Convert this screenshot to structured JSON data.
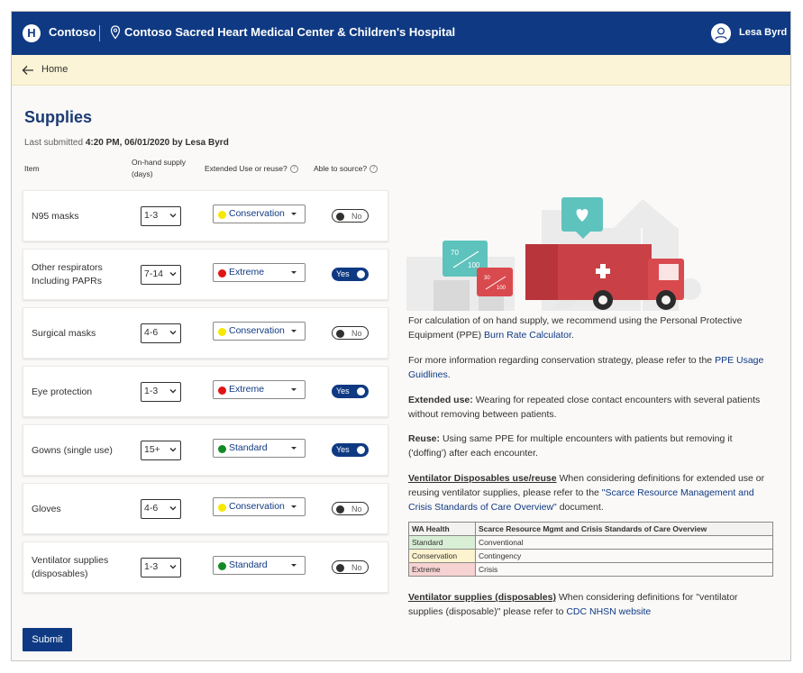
{
  "header": {
    "logo_letter": "H",
    "brand": "Contoso",
    "facility": "Contoso Sacred Heart Medical Center & Children's Hospital",
    "user_name": "Lesa Byrd"
  },
  "breadcrumb": {
    "home_label": "Home"
  },
  "page": {
    "title": "Supplies",
    "last_submitted_prefix": "Last submitted",
    "last_submitted_value": "4:20 PM, 06/01/2020 by Lesa Byrd"
  },
  "columns": {
    "item": "Item",
    "on_hand_line1": "On-hand supply",
    "on_hand_line2": "(days)",
    "extended": "Extended Use or reuse?",
    "able": "Able to source?"
  },
  "colors": {
    "conservation": "#f6e800",
    "extreme": "#e01414",
    "standard": "#138a25",
    "primary": "#0f3a83"
  },
  "rows": [
    {
      "name_line1": "N95 masks",
      "name_line2": "",
      "days": "1-3",
      "level": "Conservation",
      "source": "No"
    },
    {
      "name_line1": "Other respirators",
      "name_line2": "Including PAPRs",
      "days": "7-14",
      "level": "Extreme",
      "source": "Yes"
    },
    {
      "name_line1": "Surgical masks",
      "name_line2": "",
      "days": "4-6",
      "level": "Conservation",
      "source": "No"
    },
    {
      "name_line1": "Eye protection",
      "name_line2": "",
      "days": "1-3",
      "level": "Extreme",
      "source": "Yes"
    },
    {
      "name_line1": "Gowns (single use)",
      "name_line2": "",
      "days": "15+",
      "level": "Standard",
      "source": "Yes"
    },
    {
      "name_line1": "Gloves",
      "name_line2": "",
      "days": "4-6",
      "level": "Conservation",
      "source": "No"
    },
    {
      "name_line1": "Ventilator supplies",
      "name_line2": "(disposables)",
      "days": "1-3",
      "level": "Standard",
      "source": "No"
    }
  ],
  "submit_label": "Submit",
  "illustration": {
    "badge1_top": "70",
    "badge1_bottom": "100",
    "badge2_top": "30",
    "badge2_bottom": "100"
  },
  "info": {
    "p1_text": "For calculation of on hand supply, we recommend using the Personal Protective Equipment (PPE)",
    "p1_link": "Burn Rate Calculator",
    "p2_text": "For more information regarding conservation strategy, please refer to the",
    "p2_link": "PPE Usage Guidlines",
    "p3_bold": "Extended use:",
    "p3_text": "Wearing for repeated close contact encounters with several patients without removing between patients.",
    "p4_bold": "Reuse:",
    "p4_text": "Using same PPE for multiple encounters with patients but removing it ('doffing') after each encounter.",
    "p5_bold": "Ventilator Disposables use/reuse",
    "p5_text": "When considering definitions for extended use or reusing ventilator supplies, please refer to the",
    "p5_link": "\"Scarce Resource Management and Crisis Standards of Care Overview\"",
    "p5_tail": "document.",
    "p6_bold": "Ventilator supplies (disposables)",
    "p6_text": "When considering definitions for \"ventilator supplies (disposable)\" please refer to",
    "p6_link": "CDC NHSN website"
  },
  "legend_table": {
    "headers": [
      "WA Health",
      "Scarce Resource Mgmt and Crisis Standards of Care Overview"
    ],
    "rows": [
      {
        "level": "Standard",
        "meaning": "Conventional",
        "color": "#d8efd6"
      },
      {
        "level": "Conservation",
        "meaning": "Contingency",
        "color": "#fdf3cf"
      },
      {
        "level": "Extreme",
        "meaning": "Crisis",
        "color": "#f6d2d2"
      }
    ]
  }
}
